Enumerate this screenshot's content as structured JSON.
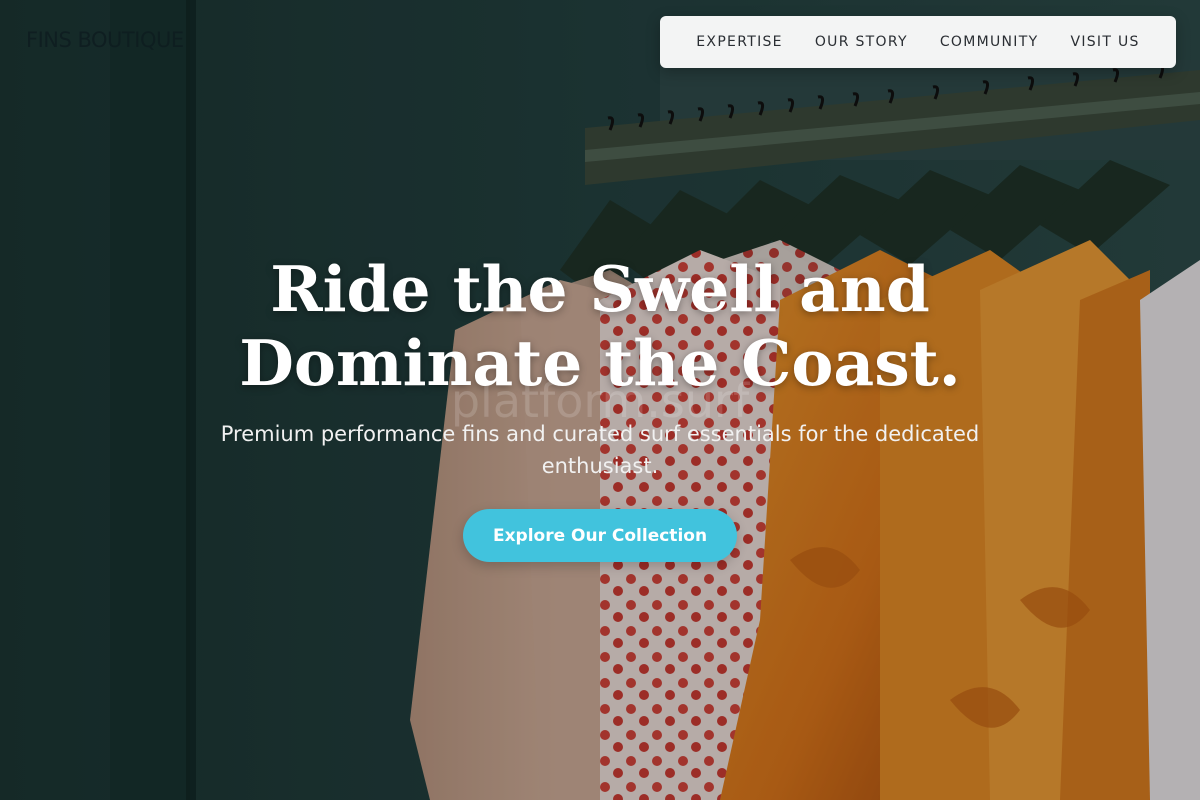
{
  "brand": {
    "name": "FINS BOUTIQUE"
  },
  "nav": {
    "items": [
      "EXPERTISE",
      "OUR STORY",
      "COMMUNITY",
      "VISIT US"
    ]
  },
  "hero": {
    "headline_line1": "Ride the Swell and",
    "headline_line2": "Dominate the Coast.",
    "ghost_text": "platform.surf",
    "subheading": "Premium performance fins and curated surf essentials for the dedicated enthusiast.",
    "cta_label": "Explore Our Collection",
    "image_description_icon": "clothing-rack-photo"
  },
  "colors": {
    "accent": "#41c3dd",
    "nav_bg": "#f3f4f4",
    "wall": "#1e3a3a"
  }
}
